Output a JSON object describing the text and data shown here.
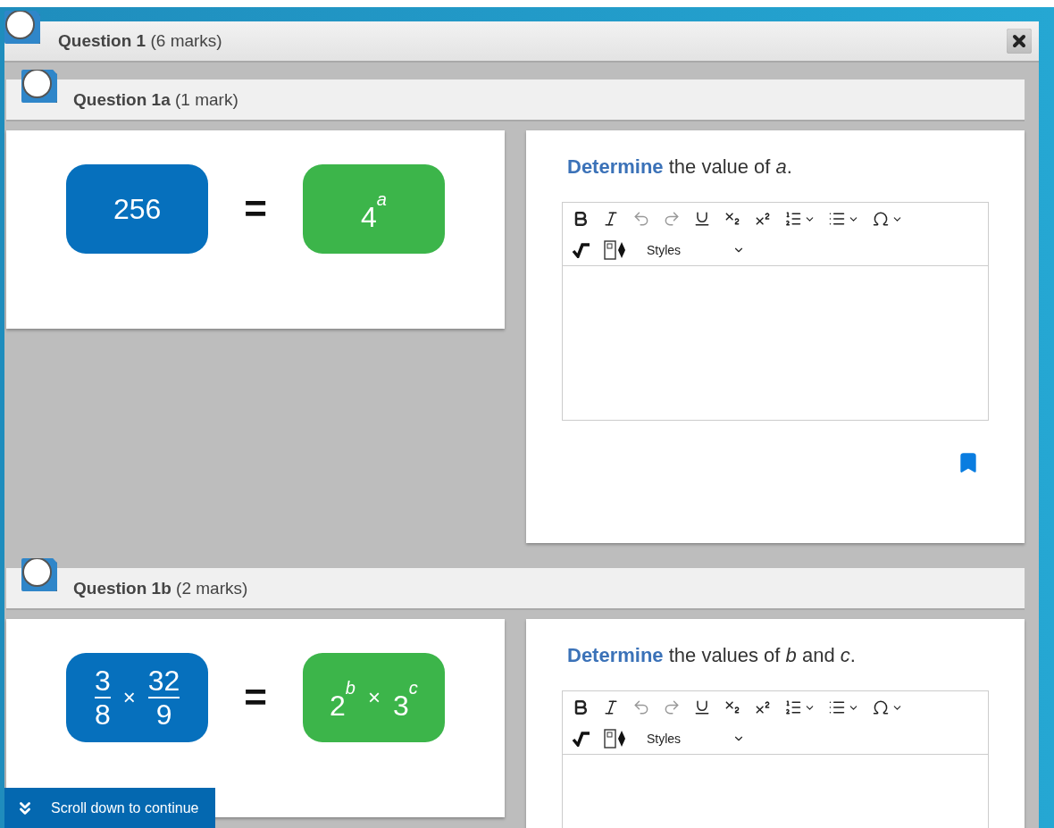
{
  "question": {
    "title": "Question 1",
    "marks": "(6 marks)"
  },
  "parts": [
    {
      "title": "Question 1a",
      "marks": "(1 mark)",
      "left": [
        {
          "kind": "text",
          "text": "256"
        }
      ],
      "equals": "=",
      "right": [
        {
          "kind": "power",
          "base": "4",
          "exp": "a"
        }
      ],
      "prompt": "**Determine** the value of *a*.",
      "tools": [
        {
          "kind": "bold"
        },
        {
          "kind": "italic"
        },
        {
          "kind": "undo"
        },
        {
          "kind": "redo"
        },
        {
          "kind": "underline"
        },
        {
          "kind": "subscript"
        },
        {
          "kind": "superscript"
        },
        {
          "kind": "ordered-list"
        },
        {
          "kind": "bullet-list"
        },
        {
          "kind": "omega"
        }
      ],
      "styles": "Styles",
      "bookmark": true
    },
    {
      "title": "Question 1b",
      "marks": "(2 marks)",
      "left": [
        {
          "kind": "fraction",
          "num": "3",
          "den": "8"
        },
        {
          "kind": "operator",
          "text": "×"
        },
        {
          "kind": "fraction",
          "num": "32",
          "den": "9"
        }
      ],
      "equals": "=",
      "right": [
        {
          "kind": "power",
          "base": "2",
          "exp": "b"
        },
        {
          "kind": "operator",
          "text": "×"
        },
        {
          "kind": "power",
          "base": "3",
          "exp": "c"
        }
      ],
      "prompt": "**Determine** the values of *b* and *c*.",
      "tools": [
        {
          "kind": "bold"
        },
        {
          "kind": "italic"
        },
        {
          "kind": "undo"
        },
        {
          "kind": "redo"
        },
        {
          "kind": "underline"
        },
        {
          "kind": "subscript"
        },
        {
          "kind": "superscript"
        },
        {
          "kind": "ordered-list"
        },
        {
          "kind": "bullet-list"
        },
        {
          "kind": "omega"
        }
      ],
      "styles": "Styles"
    }
  ],
  "scroll_hint": "Scroll down to continue"
}
